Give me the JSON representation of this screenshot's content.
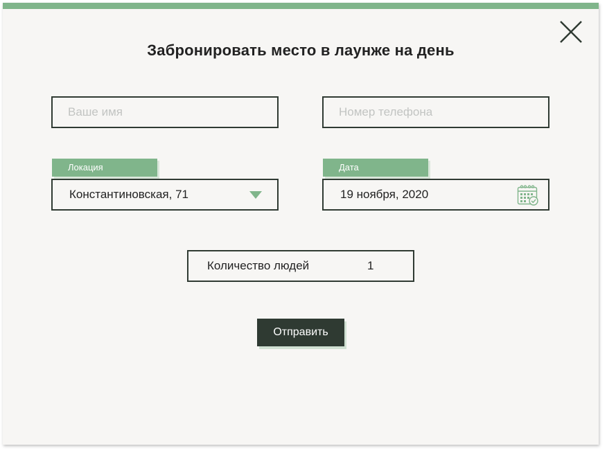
{
  "modal": {
    "title": "Забронировать место в лаунже на день",
    "close_icon": "close-icon",
    "accent_color": "#80b58b",
    "dark_color": "#2f3a32"
  },
  "form": {
    "name_placeholder": "Ваше имя",
    "phone_placeholder": "Номер телефона",
    "location": {
      "label": "Локация",
      "value": "Константиновская, 71",
      "icon": "chevron-down-icon"
    },
    "date": {
      "label": "Дата",
      "value": "19 ноября, 2020",
      "icon": "calendar-icon"
    },
    "people": {
      "label": "Количество людей",
      "value": "1"
    },
    "submit_label": "Отправить"
  }
}
